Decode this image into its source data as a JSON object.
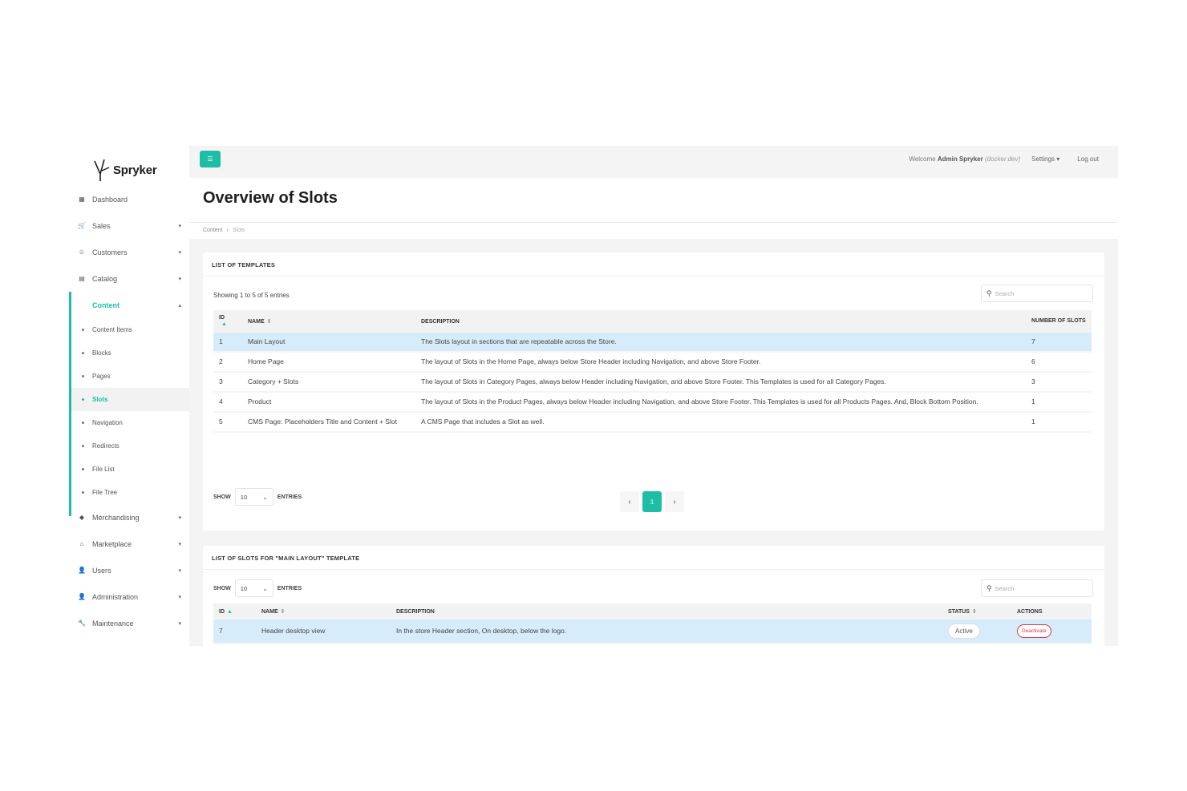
{
  "brand": {
    "name": "Spryker"
  },
  "sidebar": {
    "items": [
      {
        "label": "Dashboard",
        "icon": "dashboard-icon",
        "glyph": "▦"
      },
      {
        "label": "Sales",
        "icon": "cart-icon",
        "glyph": "🛒"
      },
      {
        "label": "Customers",
        "icon": "customers-icon",
        "glyph": "☺"
      },
      {
        "label": "Catalog",
        "icon": "catalog-icon",
        "glyph": "▤"
      },
      {
        "label": "Content",
        "icon": "",
        "glyph": ""
      }
    ],
    "content_sub": [
      {
        "label": "Content Items"
      },
      {
        "label": "Blocks"
      },
      {
        "label": "Pages"
      },
      {
        "label": "Slots"
      },
      {
        "label": "Navigation"
      },
      {
        "label": "Redirects"
      },
      {
        "label": "File List"
      },
      {
        "label": "File Tree"
      }
    ],
    "items_after": [
      {
        "label": "Merchandising",
        "icon": "merchandising-icon",
        "glyph": "◆"
      },
      {
        "label": "Marketplace",
        "icon": "marketplace-icon",
        "glyph": "⌂"
      },
      {
        "label": "Users",
        "icon": "user-icon",
        "glyph": "👤"
      },
      {
        "label": "Administration",
        "icon": "administration-icon",
        "glyph": "👤"
      },
      {
        "label": "Maintenance",
        "icon": "wrench-icon",
        "glyph": "🔧"
      }
    ]
  },
  "topbar": {
    "welcome_prefix": "Welcome",
    "user": "Admin Spryker",
    "host": "(docker.dev)",
    "settings": "Settings",
    "logout": "Log out"
  },
  "page": {
    "title": "Overview of Slots",
    "breadcrumb": [
      "Content",
      "Slots"
    ]
  },
  "templates": {
    "title": "List of templates",
    "showing": "Showing 1 to 5 of 5 entries",
    "search_placeholder": "Search",
    "columns": [
      "ID",
      "Name",
      "Description",
      "Number of slots"
    ],
    "rows": [
      {
        "id": "1",
        "name": "Main Layout",
        "description": "The Slots layout in sections that are repeatable across the Store.",
        "slots": "7"
      },
      {
        "id": "2",
        "name": "Home Page",
        "description": "The layout of Slots in the Home Page, always below Store Header including Navigation, and above Store Footer.",
        "slots": "6"
      },
      {
        "id": "3",
        "name": "Category + Slots",
        "description": "The layout of Slots in Category Pages, always below Header including Navigation, and above Store Footer. This Templates is used for all Category Pages.",
        "slots": "3"
      },
      {
        "id": "4",
        "name": "Product",
        "description": "The layout of Slots in the Product Pages, always below Header including Navigation, and above Store Footer. This Templates is used for all Products Pages. And, Block Bottom Position.",
        "slots": "1"
      },
      {
        "id": "5",
        "name": "CMS Page: Placeholders Title and Content + Slot",
        "description": "A CMS Page that includes a Slot as well.",
        "slots": "1"
      }
    ],
    "show_label": "Show",
    "entries_label": "Entries",
    "page_size": "10",
    "pagination": {
      "current": "1",
      "prev": "‹",
      "next": "›"
    }
  },
  "slots": {
    "title": "List of slots for \"Main Layout\" template",
    "show_label": "Show",
    "entries_label": "Entries",
    "page_size": "10",
    "search_placeholder": "Search",
    "columns": [
      "ID",
      "Name",
      "Description",
      "Status",
      "Actions"
    ],
    "rows": [
      {
        "id": "7",
        "name": "Header desktop view",
        "description": "In the store Header section, On desktop, below the logo.",
        "status": "Active",
        "action": "Deactivate"
      }
    ]
  },
  "colors": {
    "accent": "#1ebea5",
    "highlight_row": "#d6ecfa",
    "danger": "#e0364b"
  }
}
